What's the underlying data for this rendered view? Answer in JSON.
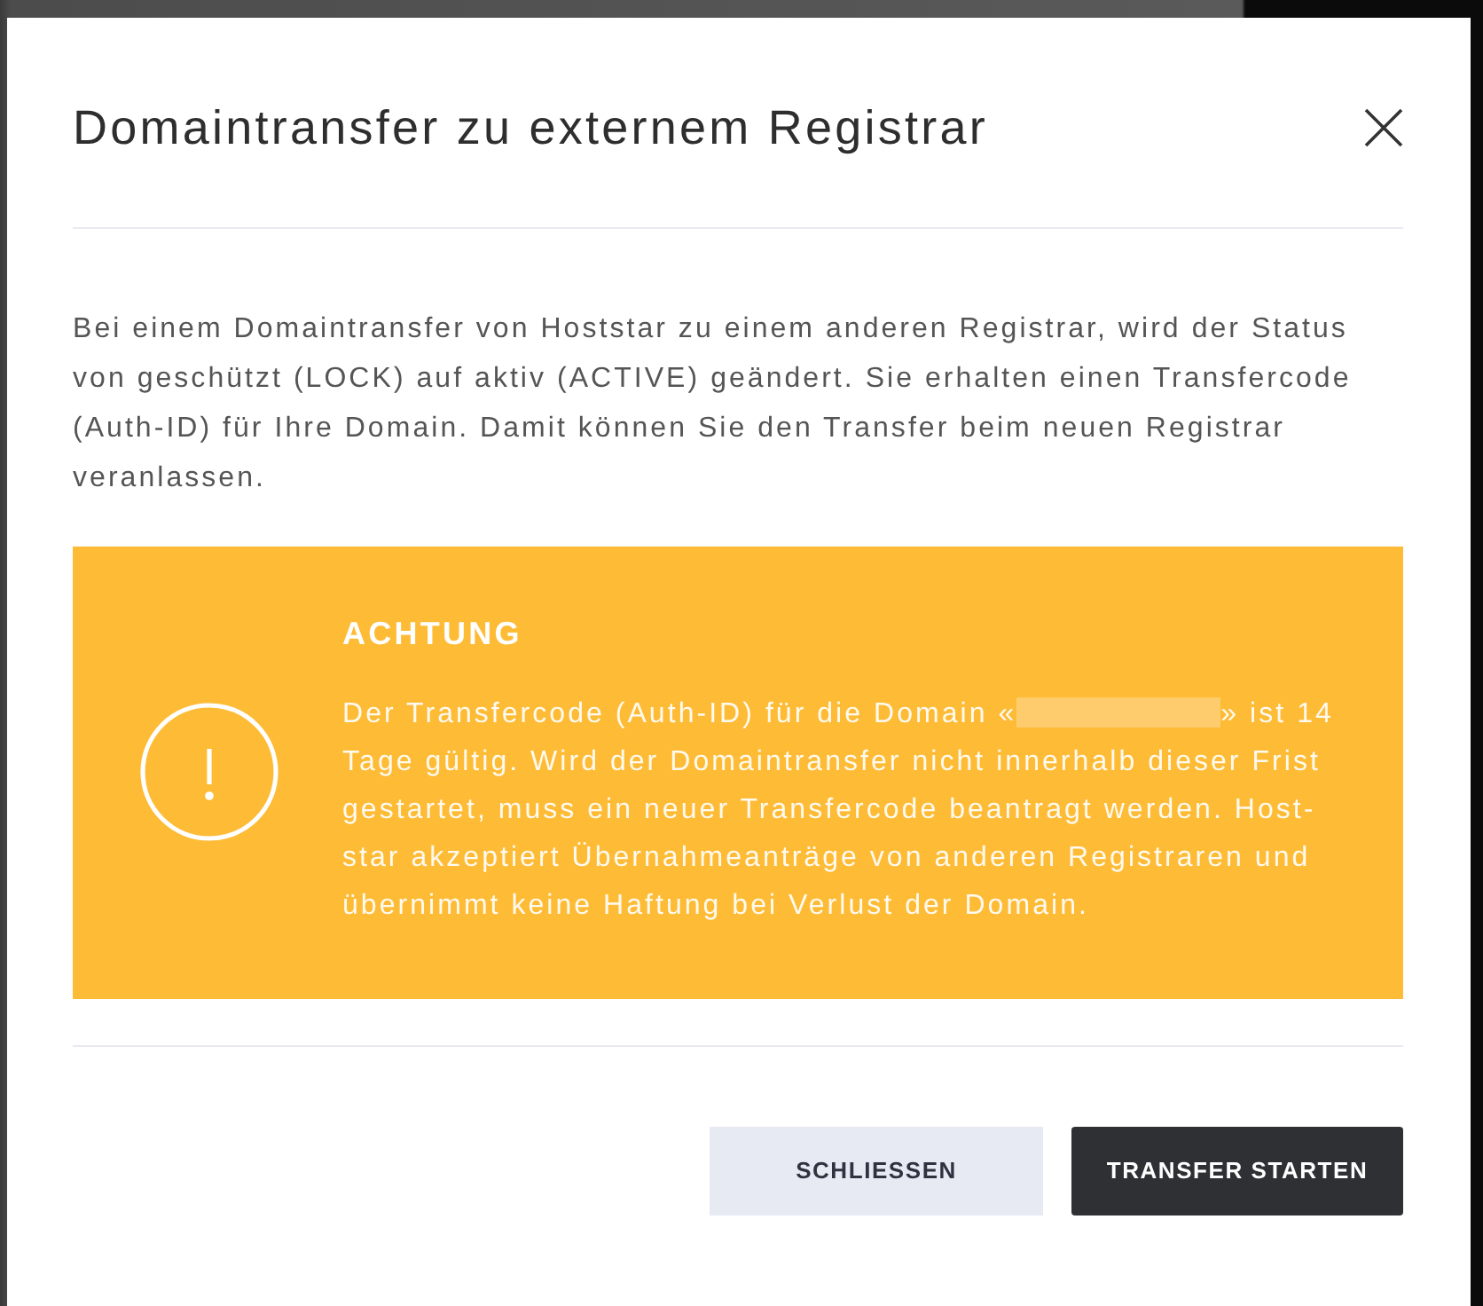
{
  "dialog": {
    "title": "Domaintransfer zu externem Registrar",
    "intro": "Bei einem Domaintransfer von Hoststar zu einem anderen Registrar, wird der Status von geschützt (LOCK) auf aktiv (ACTIVE) geändert. Sie erhalten einen Transfercode (Auth-ID) für Ihre Domain. Damit können Sie den Transfer beim neuen Registrar veranlassen.",
    "alert": {
      "kind": "warning",
      "title": "ACHTUNG",
      "body": [
        {
          "kind": "text",
          "text": "Der Transfercode (Auth-ID) für die Domain «"
        },
        {
          "kind": "redacted"
        },
        {
          "kind": "text",
          "text": "» ist 14 Tage gültig. Wird der Domaintransfer nicht innerhalb dieser Frist gestartet, muss ein neuer Transfercode beantragt werden. Host-star akzeptiert Übernahmeanträge von anderen Registraren und übernimmt keine Haftung bei Verlust der Domain."
        }
      ]
    },
    "buttons": [
      {
        "label": "SCHLIESSEN",
        "kind": "secondary"
      },
      {
        "label": "TRANSFER STARTEN",
        "kind": "primary"
      }
    ]
  }
}
